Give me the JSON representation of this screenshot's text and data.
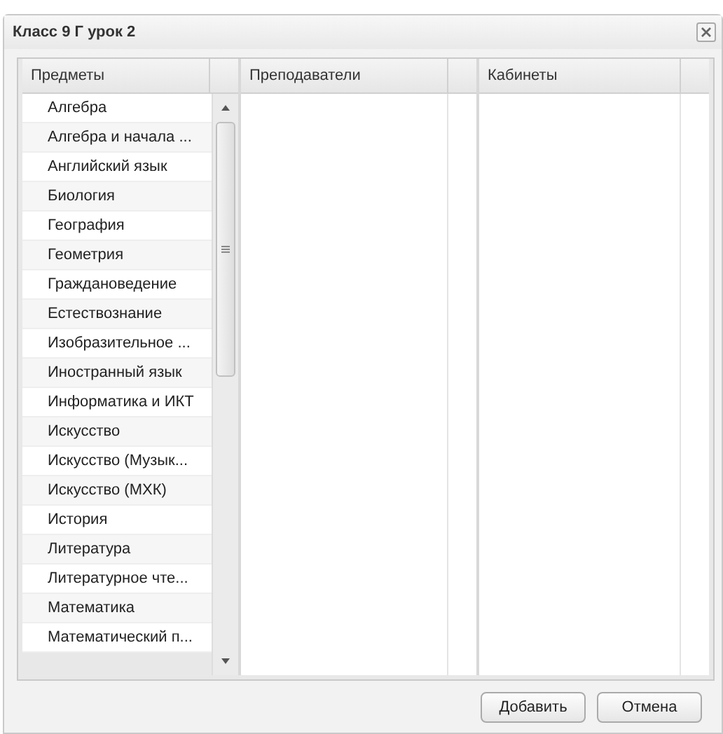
{
  "window": {
    "title": "Класс 9 Г урок 2"
  },
  "columns": [
    {
      "label": "Предметы"
    },
    {
      "label": "Преподаватели"
    },
    {
      "label": "Кабинеты"
    }
  ],
  "subjects": [
    "Алгебра",
    "Алгебра и начала ...",
    "Английский язык",
    "Биология",
    "География",
    "Геометрия",
    "Граждановедение",
    "Естествознание",
    "Изобразительное ...",
    "Иностранный язык",
    "Информатика и ИКТ",
    "Искусство",
    "Искусство (Музык...",
    "Искусство (МХК)",
    "История",
    "Литература",
    "Литературное чте...",
    "Математика",
    "Математический п..."
  ],
  "buttons": [
    "Добавить",
    "Отмена"
  ]
}
